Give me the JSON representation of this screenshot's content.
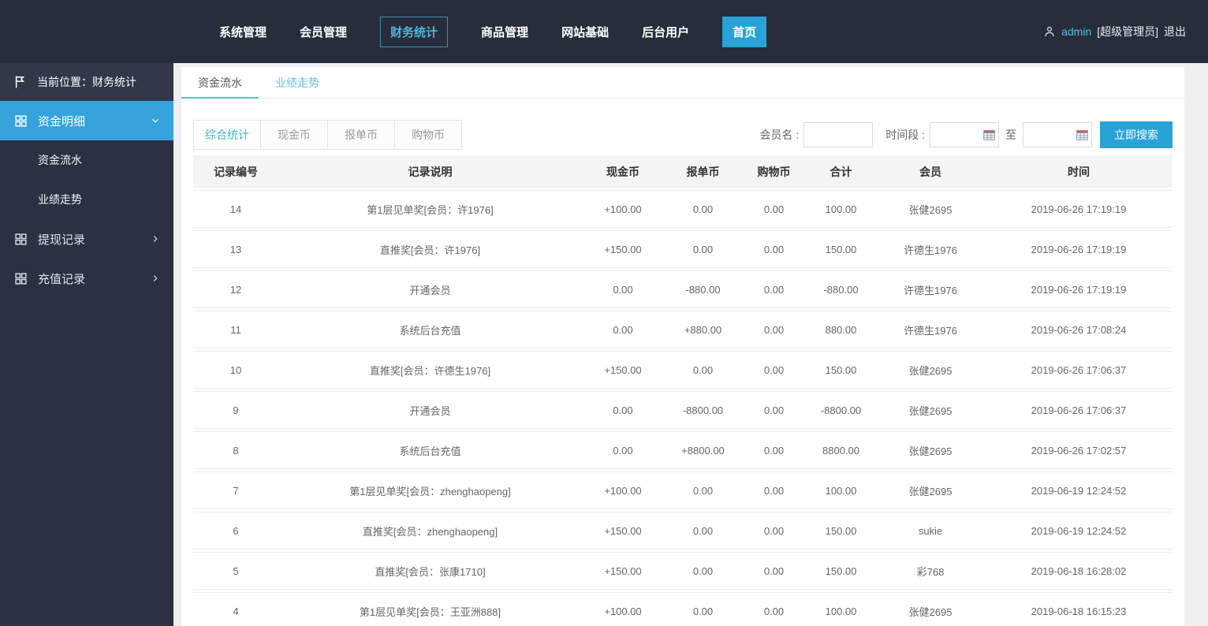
{
  "topbar": {
    "nav": [
      {
        "label": "系统管理"
      },
      {
        "label": "会员管理"
      },
      {
        "label": "财务统计",
        "variant": "outlined"
      },
      {
        "label": "商品管理"
      },
      {
        "label": "网站基础"
      },
      {
        "label": "后台用户"
      },
      {
        "label": "首页",
        "variant": "solid"
      }
    ],
    "user": {
      "name": "admin",
      "role": "[超级管理员]",
      "logout": "退出"
    }
  },
  "sidebar": {
    "breadcrumb": "当前位置：财务统计",
    "menu": [
      {
        "label": "资金明细",
        "active": true,
        "expanded": true,
        "children": [
          "资金流水",
          "业绩走势"
        ]
      },
      {
        "label": "提现记录",
        "active": false,
        "expanded": false,
        "children": []
      },
      {
        "label": "充值记录",
        "active": false,
        "expanded": false,
        "children": []
      }
    ]
  },
  "main": {
    "tabs": [
      {
        "label": "资金流水",
        "active": true
      },
      {
        "label": "业绩走势",
        "active": false
      }
    ],
    "subtabs": [
      {
        "label": "综合统计",
        "active": true
      },
      {
        "label": "现金币",
        "active": false
      },
      {
        "label": "报单币",
        "active": false
      },
      {
        "label": "购物币",
        "active": false
      }
    ],
    "search": {
      "member_label": "会员名 :",
      "time_label": "时间段 :",
      "to_label": "至",
      "button": "立即搜索"
    },
    "table": {
      "headers": [
        "记录编号",
        "记录说明",
        "现金币",
        "报单币",
        "购物币",
        "合计",
        "会员",
        "时间"
      ],
      "rows": [
        [
          "14",
          "第1层见单奖[会员：许1976]",
          "+100.00",
          "0.00",
          "0.00",
          "100.00",
          "张健2695",
          "2019-06-26 17:19:19"
        ],
        [
          "13",
          "直推奖[会员：许1976]",
          "+150.00",
          "0.00",
          "0.00",
          "150.00",
          "许德生1976",
          "2019-06-26 17:19:19"
        ],
        [
          "12",
          "开通会员",
          "0.00",
          "-880.00",
          "0.00",
          "-880.00",
          "许德生1976",
          "2019-06-26 17:19:19"
        ],
        [
          "11",
          "系统后台充值",
          "0.00",
          "+880.00",
          "0.00",
          "880.00",
          "许德生1976",
          "2019-06-26 17:08:24"
        ],
        [
          "10",
          "直推奖[会员：许德生1976]",
          "+150.00",
          "0.00",
          "0.00",
          "150.00",
          "张健2695",
          "2019-06-26 17:06:37"
        ],
        [
          "9",
          "开通会员",
          "0.00",
          "-8800.00",
          "0.00",
          "-8800.00",
          "张健2695",
          "2019-06-26 17:06:37"
        ],
        [
          "8",
          "系统后台充值",
          "0.00",
          "+8800.00",
          "0.00",
          "8800.00",
          "张健2695",
          "2019-06-26 17:02:57"
        ],
        [
          "7",
          "第1层见单奖[会员：zhenghaopeng]",
          "+100.00",
          "0.00",
          "0.00",
          "100.00",
          "张健2695",
          "2019-06-19 12:24:52"
        ],
        [
          "6",
          "直推奖[会员：zhenghaopeng]",
          "+150.00",
          "0.00",
          "0.00",
          "150.00",
          "sukie",
          "2019-06-19 12:24:52"
        ],
        [
          "5",
          "直推奖[会员：张康1710]",
          "+150.00",
          "0.00",
          "0.00",
          "150.00",
          "彩768",
          "2019-06-18 16:28:02"
        ],
        [
          "4",
          "第1层见单奖[会员：王亚洲888]",
          "+100.00",
          "0.00",
          "0.00",
          "100.00",
          "张健2695",
          "2019-06-18 16:15:23"
        ]
      ]
    }
  },
  "colors": {
    "topbar_bg": "#272d3b",
    "sidebar_bg": "#2a3140",
    "active_menu_blue": "#36a3dc",
    "button_blue": "#29a3d7",
    "tab_teal": "#53c4ce",
    "table_header_bg": "#f4f4f4"
  }
}
